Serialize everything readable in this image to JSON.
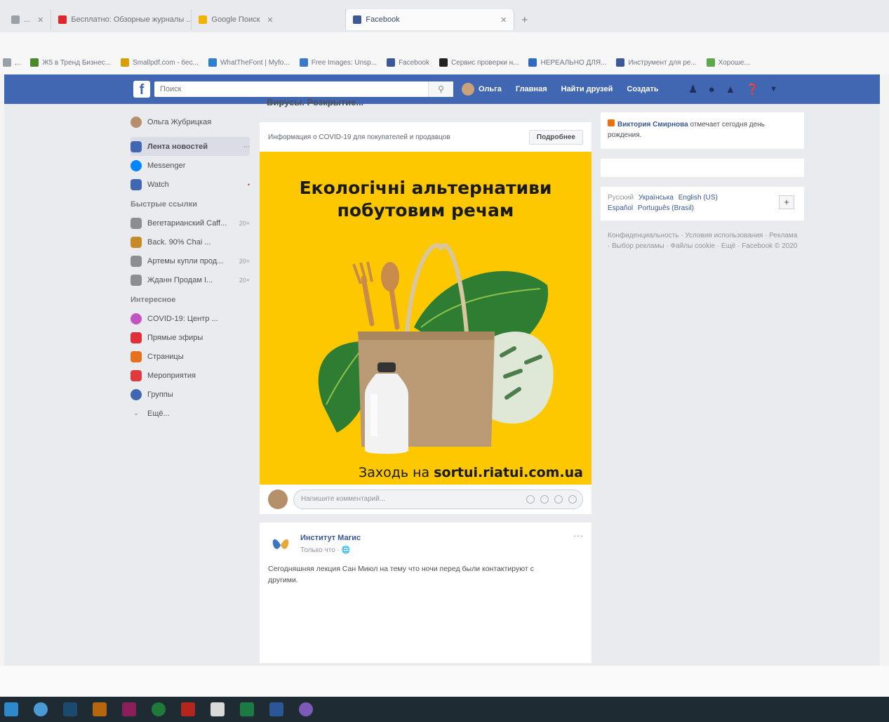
{
  "browser": {
    "tabs": [
      {
        "label": "...",
        "color": "#9aa0a8"
      },
      {
        "label": "Бесплатно: Обзорные журналы ...",
        "color": "#e0262a"
      },
      {
        "label": "Google Поиск",
        "color": "#f0b400"
      },
      {
        "label": "Facebook",
        "color": "#3b5998",
        "active": true
      }
    ],
    "new_tab": "+",
    "bookmarks": [
      {
        "label": "...",
        "color": "#9aa0a8"
      },
      {
        "label": "Ж5 в Тренд Бизнес...",
        "color": "#4a8a2a"
      },
      {
        "label": "Smallpdf.com - бес...",
        "color": "#d7a000"
      },
      {
        "label": "WhatTheFont | Myfo...",
        "color": "#2e7fd3"
      },
      {
        "label": "Free Images: Unsp...",
        "color": "#3a79c7"
      },
      {
        "label": "Facebook",
        "color": "#3b5998"
      },
      {
        "label": "Сервис проверки н...",
        "color": "#222222"
      },
      {
        "label": "НЕРЕАЛЬНО ДЛЯ...",
        "color": "#2f6bc2"
      },
      {
        "label": "Инструмент для ре...",
        "color": "#3b5998"
      },
      {
        "label": "Хороше...",
        "color": "#5da84a"
      }
    ]
  },
  "fb_header": {
    "logo": "f",
    "search_placeholder": "Поиск",
    "search_icon": "search-icon",
    "profile_name": "Ольга",
    "nav": [
      "Главная",
      "Найти друзей",
      "Создать"
    ],
    "icons": [
      "friends-icon",
      "messenger-icon",
      "notifications-icon",
      "help-icon",
      "chevron-down-icon"
    ]
  },
  "left_nav": {
    "profile": {
      "label": "Ольга Жубрицкая",
      "color": "#b58e6a"
    },
    "main": [
      {
        "label": "Лента новостей",
        "color": "#4267b2",
        "count": "···",
        "selected": true
      },
      {
        "label": "Messenger",
        "color": "#0084ff"
      },
      {
        "label": "Watch",
        "color": "#4267b2",
        "count": "•"
      }
    ],
    "shortcuts_heading": "Быстрые ссылки",
    "shortcuts": [
      {
        "label": "Вегетарианский Caff...",
        "color": "#8a8d91",
        "count": "20+"
      },
      {
        "label": "Back. 90% Chai ...",
        "color": "#c58b2a",
        "count": ""
      },
      {
        "label": "Артемы купли прод...",
        "color": "#8a8d91",
        "count": "20+"
      },
      {
        "label": "Жданн Продам І...",
        "color": "#8a8d91",
        "count": "20+"
      }
    ],
    "explore_heading": "Интересное",
    "explore": [
      {
        "label": "COVID-19: Центр ...",
        "color": "#c154c1"
      },
      {
        "label": "Прямые эфиры",
        "color": "#e02e3a"
      },
      {
        "label": "Страницы",
        "color": "#e6711d"
      },
      {
        "label": "Мероприятия",
        "color": "#e0393e"
      },
      {
        "label": "Группы",
        "color": "#4267b2"
      },
      {
        "label": "Ещё...",
        "color": "#8a8d91"
      }
    ]
  },
  "feed": {
    "title": "Вирусы. Розкрытие...",
    "covid_text": "Информация о COVID-19 для покупателей и продавцов",
    "covid_button": "Подробнее",
    "ad": {
      "headline_line1": "Екологічні альтернативи",
      "headline_line2": "побутовим речам",
      "footer_prefix": "Заходь на",
      "footer_url": "sortui.riatui.com.ua",
      "bg_color": "#fdc800"
    },
    "comment_placeholder": "Напишите комментарий...",
    "post": {
      "author": "Институт Магис",
      "time": "Только что · 🌐",
      "more": "···",
      "text": "Сегодняшняя лекция Сан Миюл на тему что ночи перед были контактируют с другими."
    }
  },
  "right_col": {
    "birthday_name": "Виктория Смирнова",
    "birthday_text": "отмечает сегодня день рождения.",
    "languages_current": "Русский",
    "languages": [
      "Українська",
      "English (US)",
      "Español",
      "Português (Brasil)"
    ],
    "languages_add": "+",
    "footer": "Конфиденциальность · Условия использования · Реклама · Выбор рекламы · Файлы cookie · Ещё · Facebook © 2020"
  },
  "taskbar": {
    "icons": [
      {
        "name": "start-icon",
        "color": "#2f88c9"
      },
      {
        "name": "chrome-icon",
        "color": "#4a9ad4"
      },
      {
        "name": "photoshop-icon",
        "color": "#1c4a6e"
      },
      {
        "name": "illustrator-icon",
        "color": "#b5660e"
      },
      {
        "name": "indesign-icon",
        "color": "#8a1e5a"
      },
      {
        "name": "corel-icon",
        "color": "#1f7a3a"
      },
      {
        "name": "acrobat-icon",
        "color": "#b3261e"
      },
      {
        "name": "notes-icon",
        "color": "#d9d9d9"
      },
      {
        "name": "excel-icon",
        "color": "#1d7a44"
      },
      {
        "name": "word-icon",
        "color": "#2b5797"
      },
      {
        "name": "viber-icon",
        "color": "#7b5bb7"
      }
    ]
  }
}
